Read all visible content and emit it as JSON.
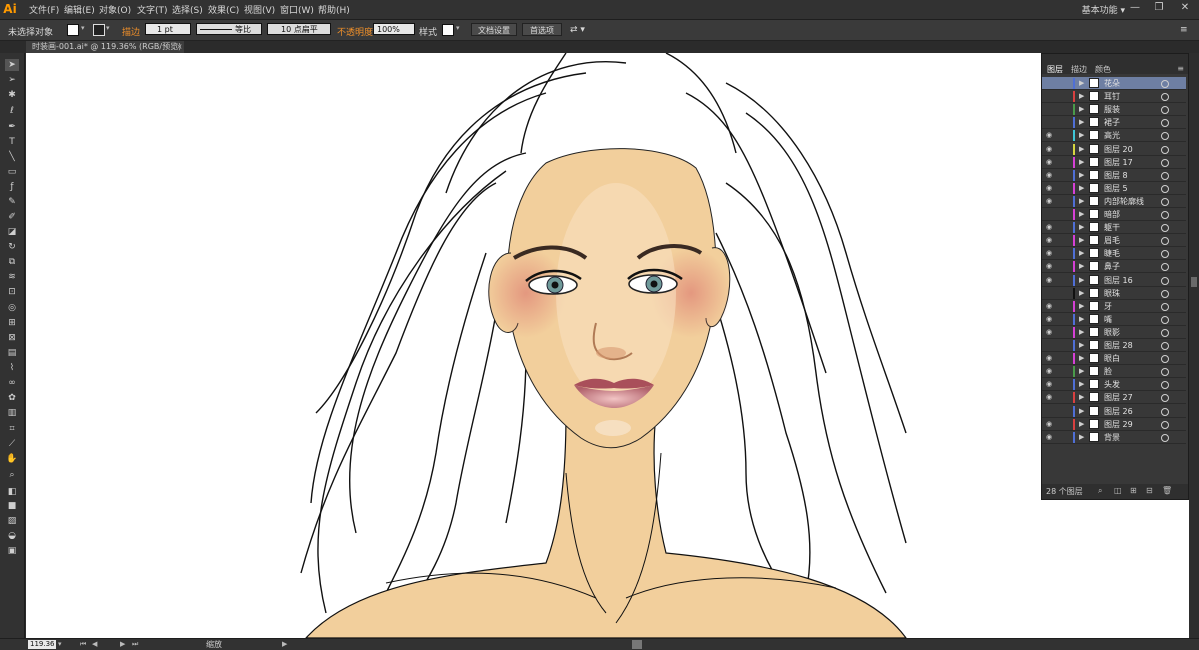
{
  "app": {
    "logo": "Ai",
    "workspace": "基本功能",
    "workspace_arrow": "▾"
  },
  "menu": [
    {
      "label": "文件(F)",
      "name": "menu-file"
    },
    {
      "label": "编辑(E)",
      "name": "menu-edit"
    },
    {
      "label": "对象(O)",
      "name": "menu-object"
    },
    {
      "label": "文字(T)",
      "name": "menu-type"
    },
    {
      "label": "选择(S)",
      "name": "menu-select"
    },
    {
      "label": "效果(C)",
      "name": "menu-effect"
    },
    {
      "label": "视图(V)",
      "name": "menu-view"
    },
    {
      "label": "窗口(W)",
      "name": "menu-window"
    },
    {
      "label": "帮助(H)",
      "name": "menu-help"
    }
  ],
  "window_buttons": [
    "—",
    "❐",
    "✕"
  ],
  "control": {
    "selection": "未选择对象",
    "stroke_label": "描边",
    "stroke_weight": "1 pt",
    "stroke_profile": "等比",
    "brush": "10 点扁平",
    "opacity_label": "不透明度",
    "opacity_value": "100%",
    "style_label": "样式",
    "doc_setup": "文档设置",
    "prefs": "首选项"
  },
  "document_tab": {
    "title": "时装画-001.ai* @ 119.36% (RGB/预览)",
    "close": "×"
  },
  "tools": [
    {
      "name": "selection-tool-icon",
      "glyph": "➤"
    },
    {
      "name": "direct-selection-tool-icon",
      "glyph": "➢"
    },
    {
      "name": "magic-wand-tool-icon",
      "glyph": "✱"
    },
    {
      "name": "lasso-tool-icon",
      "glyph": "ℓ"
    },
    {
      "name": "pen-tool-icon",
      "glyph": "✒"
    },
    {
      "name": "type-tool-icon",
      "glyph": "T"
    },
    {
      "name": "line-tool-icon",
      "glyph": "╲"
    },
    {
      "name": "rectangle-tool-icon",
      "glyph": "▭"
    },
    {
      "name": "paintbrush-tool-icon",
      "glyph": "ƒ"
    },
    {
      "name": "pencil-tool-icon",
      "glyph": "✎"
    },
    {
      "name": "blob-brush-tool-icon",
      "glyph": "✐"
    },
    {
      "name": "eraser-tool-icon",
      "glyph": "◪"
    },
    {
      "name": "rotate-tool-icon",
      "glyph": "↻"
    },
    {
      "name": "scale-tool-icon",
      "glyph": "⧉"
    },
    {
      "name": "warp-tool-icon",
      "glyph": "≋"
    },
    {
      "name": "free-transform-tool-icon",
      "glyph": "⊡"
    },
    {
      "name": "shape-builder-tool-icon",
      "glyph": "◎"
    },
    {
      "name": "perspective-grid-tool-icon",
      "glyph": "⊞"
    },
    {
      "name": "mesh-tool-icon",
      "glyph": "⊠"
    },
    {
      "name": "gradient-tool-icon",
      "glyph": "▤"
    },
    {
      "name": "eyedropper-tool-icon",
      "glyph": "⌇"
    },
    {
      "name": "blend-tool-icon",
      "glyph": "∞"
    },
    {
      "name": "symbol-sprayer-tool-icon",
      "glyph": "✿"
    },
    {
      "name": "column-graph-tool-icon",
      "glyph": "▥"
    },
    {
      "name": "artboard-tool-icon",
      "glyph": "⌗"
    },
    {
      "name": "slice-tool-icon",
      "glyph": "⟋"
    },
    {
      "name": "hand-tool-icon",
      "glyph": "✋"
    },
    {
      "name": "zoom-tool-icon",
      "glyph": "⌕"
    },
    {
      "name": "default-colors-icon",
      "glyph": "◧"
    },
    {
      "name": "fill-stroke-icon",
      "glyph": "■"
    },
    {
      "name": "color-mode-icon",
      "glyph": "▨"
    },
    {
      "name": "drawing-mode-icon",
      "glyph": "◒"
    },
    {
      "name": "screen-mode-icon",
      "glyph": "▣"
    }
  ],
  "layers_panel": {
    "tabs": [
      "图层",
      "描边",
      "颜色"
    ],
    "layers": [
      {
        "name": "花朵",
        "visible": false,
        "color": "#4f6fd6",
        "selected": true
      },
      {
        "name": "耳钉",
        "visible": false,
        "color": "#d94040"
      },
      {
        "name": "服装",
        "visible": false,
        "color": "#4a9a4a"
      },
      {
        "name": "裙子",
        "visible": false,
        "color": "#4f6fd6"
      },
      {
        "name": "高光",
        "visible": true,
        "color": "#3fc7d9"
      },
      {
        "name": "图层 20",
        "visible": true,
        "color": "#d6d640"
      },
      {
        "name": "图层 17",
        "visible": true,
        "color": "#d640d6"
      },
      {
        "name": "图层 8",
        "visible": true,
        "color": "#4f6fd6"
      },
      {
        "name": "图层 5",
        "visible": true,
        "color": "#d640d6"
      },
      {
        "name": "内部轮廓线",
        "visible": true,
        "color": "#4f6fd6"
      },
      {
        "name": "暗部",
        "visible": false,
        "color": "#d640d6"
      },
      {
        "name": "躯干",
        "visible": true,
        "color": "#4f6fd6"
      },
      {
        "name": "眉毛",
        "visible": true,
        "color": "#d640d6"
      },
      {
        "name": "睫毛",
        "visible": true,
        "color": "#4f6fd6"
      },
      {
        "name": "鼻子",
        "visible": true,
        "color": "#d640d6"
      },
      {
        "name": "图层 16",
        "visible": true,
        "color": "#4f6fd6"
      },
      {
        "name": "眼珠",
        "visible": false,
        "color": "#111111"
      },
      {
        "name": "牙",
        "visible": true,
        "color": "#d640d6"
      },
      {
        "name": "嘴",
        "visible": true,
        "color": "#4f6fd6"
      },
      {
        "name": "眼影",
        "visible": true,
        "color": "#d640d6"
      },
      {
        "name": "图层 28",
        "visible": false,
        "color": "#4f6fd6"
      },
      {
        "name": "眼白",
        "visible": true,
        "color": "#d640d6"
      },
      {
        "name": "脸",
        "visible": true,
        "color": "#4a9a4a"
      },
      {
        "name": "头发",
        "visible": true,
        "color": "#4f6fd6"
      },
      {
        "name": "图层 27",
        "visible": true,
        "color": "#d94040"
      },
      {
        "name": "图层 26",
        "visible": false,
        "color": "#4f6fd6"
      },
      {
        "name": "图层 29",
        "visible": true,
        "color": "#d94040"
      },
      {
        "name": "背景",
        "visible": true,
        "color": "#4f6fd6"
      }
    ],
    "count_label": "28 个图层"
  },
  "status": {
    "zoom": "119.36",
    "tool_label": "缩放"
  },
  "colors": {
    "skin": "#f2cf9c",
    "accent": "#f0902a"
  }
}
